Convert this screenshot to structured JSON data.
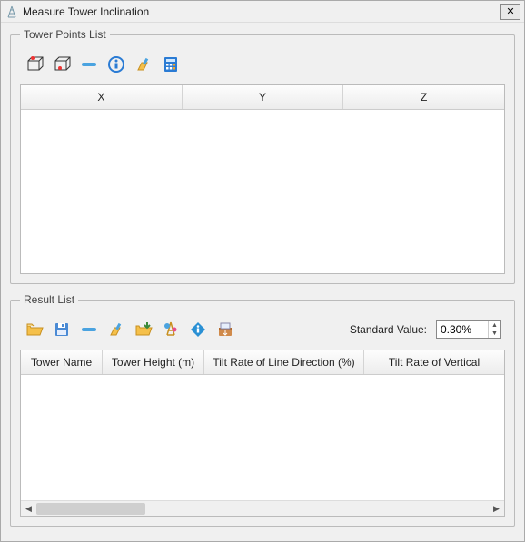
{
  "window": {
    "title": "Measure Tower Inclination"
  },
  "points": {
    "legend": "Tower Points List",
    "toolbar": [
      {
        "name": "measure-top-icon"
      },
      {
        "name": "measure-bottom-icon"
      },
      {
        "name": "delete-icon"
      },
      {
        "name": "info-icon"
      },
      {
        "name": "clear-icon"
      },
      {
        "name": "calculate-icon"
      }
    ],
    "columns": [
      "X",
      "Y",
      "Z"
    ],
    "rows": []
  },
  "result": {
    "legend": "Result List",
    "toolbar": [
      {
        "name": "open-icon"
      },
      {
        "name": "save-icon"
      },
      {
        "name": "delete-icon"
      },
      {
        "name": "clear-icon"
      },
      {
        "name": "load-icon"
      },
      {
        "name": "import-icon"
      },
      {
        "name": "info-icon"
      },
      {
        "name": "export-icon"
      }
    ],
    "standard_label": "Standard Value:",
    "standard_value": "0.30%",
    "columns": [
      "Tower Name",
      "Tower Height (m)",
      "Tilt Rate of Line Direction (%)",
      "Tilt Rate of Vertical"
    ],
    "rows": []
  }
}
